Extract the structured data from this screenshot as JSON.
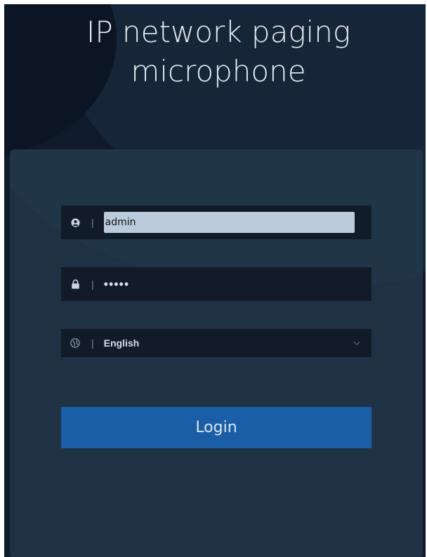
{
  "header": {
    "title_line1": "IP network paging",
    "title_line2": "microphone"
  },
  "login_form": {
    "username": {
      "icon": "user-icon",
      "value": "admin"
    },
    "password": {
      "icon": "lock-icon",
      "value": "•••••"
    },
    "language": {
      "icon": "globe-icon",
      "selected": "English",
      "dropdown_icon": "chevron-down-icon"
    },
    "login_label": "Login"
  },
  "colors": {
    "background": "#0f1b2b",
    "card": "#1e3243",
    "field": "#111c28",
    "accent": "#1a5ea8"
  }
}
